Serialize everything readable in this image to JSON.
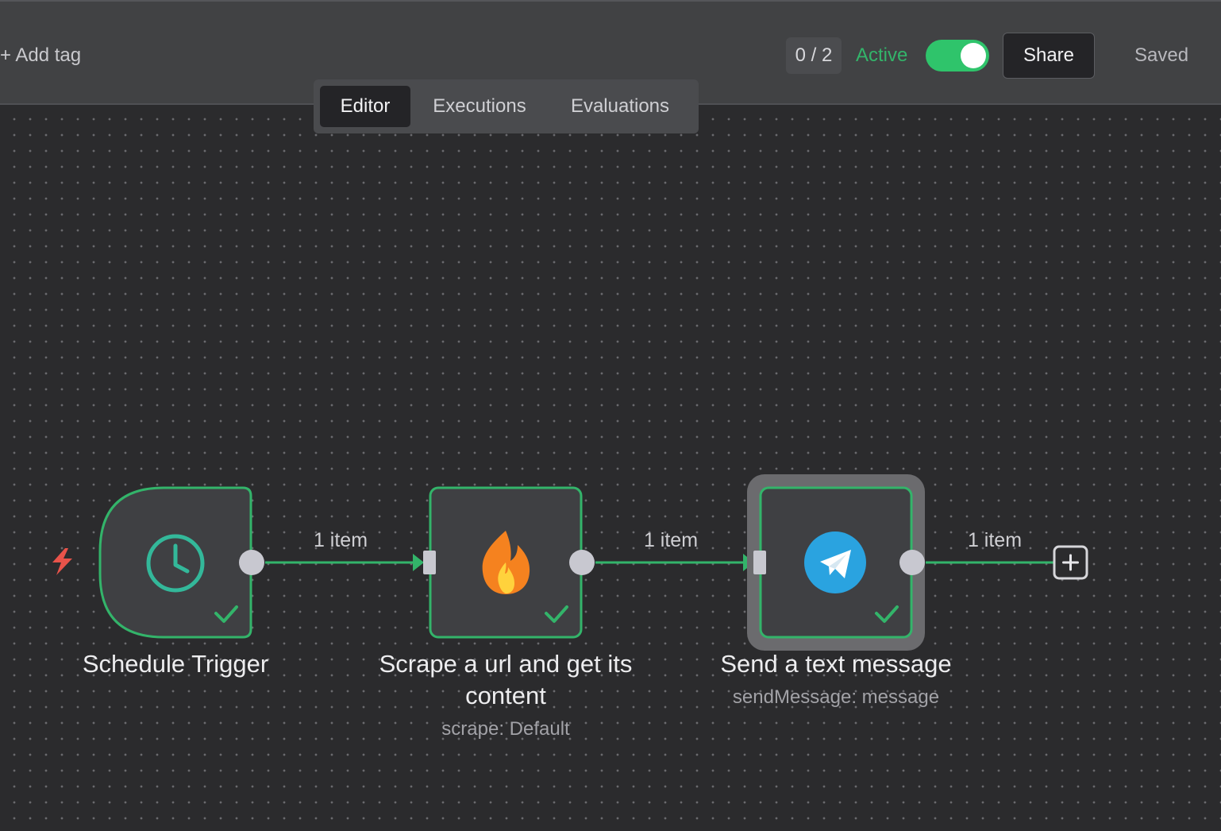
{
  "header": {
    "add_tag": "+ Add tag",
    "counter": "0 / 2",
    "active_label": "Active",
    "active_on": true,
    "share_label": "Share",
    "saved_label": "Saved"
  },
  "tabs": [
    {
      "label": "Editor",
      "selected": true
    },
    {
      "label": "Executions",
      "selected": false
    },
    {
      "label": "Evaluations",
      "selected": false
    }
  ],
  "nodes": [
    {
      "name": "Schedule Trigger",
      "subtitle": "",
      "icon": "clock-icon",
      "status": "success"
    },
    {
      "name": "Scrape a url and get its content",
      "name_line1": "Scrape a url and get its",
      "name_line2": "content",
      "subtitle": "scrape: Default",
      "icon": "firecrawl-fire-icon",
      "status": "success"
    },
    {
      "name": "Send a text message",
      "subtitle": "sendMessage: message",
      "icon": "telegram-icon",
      "status": "success",
      "selected": true
    }
  ],
  "edges": [
    {
      "label": "1 item"
    },
    {
      "label": "1 item"
    },
    {
      "label": "1 item"
    }
  ],
  "colors": {
    "success_green": "#33b46a",
    "trigger_red": "#e8534a",
    "telegram_blue": "#2aa3e0"
  }
}
